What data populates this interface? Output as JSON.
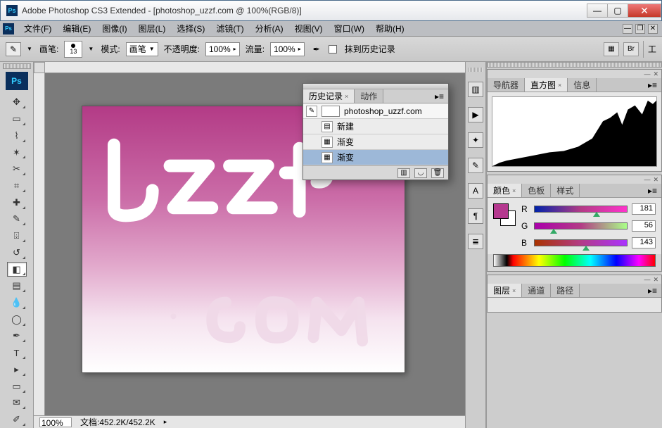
{
  "app": {
    "title": "Adobe Photoshop CS3 Extended - [photoshop_uzzf.com @ 100%(RGB/8)]",
    "badge": "Ps"
  },
  "menu": {
    "items": [
      "文件(F)",
      "编辑(E)",
      "图像(I)",
      "图层(L)",
      "选择(S)",
      "滤镜(T)",
      "分析(A)",
      "视图(V)",
      "窗口(W)",
      "帮助(H)"
    ]
  },
  "options": {
    "brush_label": "画笔:",
    "brush_size": "13",
    "mode_label": "模式:",
    "mode_value": "画笔",
    "opacity_label": "不透明度:",
    "opacity_value": "100%",
    "flow_label": "流量:",
    "flow_value": "100%",
    "history_brush_label": "抹到历史记录",
    "right_label": "工"
  },
  "status": {
    "zoom": "100%",
    "docinfo_label": "文档:",
    "docinfo_value": "452.2K/452.2K"
  },
  "history_panel": {
    "tab_history": "历史记录",
    "tab_actions": "动作",
    "doc_name": "photoshop_uzzf.com",
    "step_new": "新建",
    "step_grad1": "渐变",
    "step_grad2": "渐变"
  },
  "nav_panel": {
    "tab_nav": "导航器",
    "tab_hist": "直方图",
    "tab_info": "信息"
  },
  "color_panel": {
    "tab_color": "颜色",
    "tab_swatch": "色板",
    "tab_styles": "样式",
    "R_label": "R",
    "G_label": "G",
    "B_label": "B",
    "R": "181",
    "G": "56",
    "B": "143",
    "fg_hex": "#b5388f"
  },
  "layer_panel": {
    "tab_layers": "图层",
    "tab_channels": "通道",
    "tab_paths": "路径"
  },
  "canvas": {
    "text_top": "Uzzf",
    "text_bot": ". c o m"
  }
}
